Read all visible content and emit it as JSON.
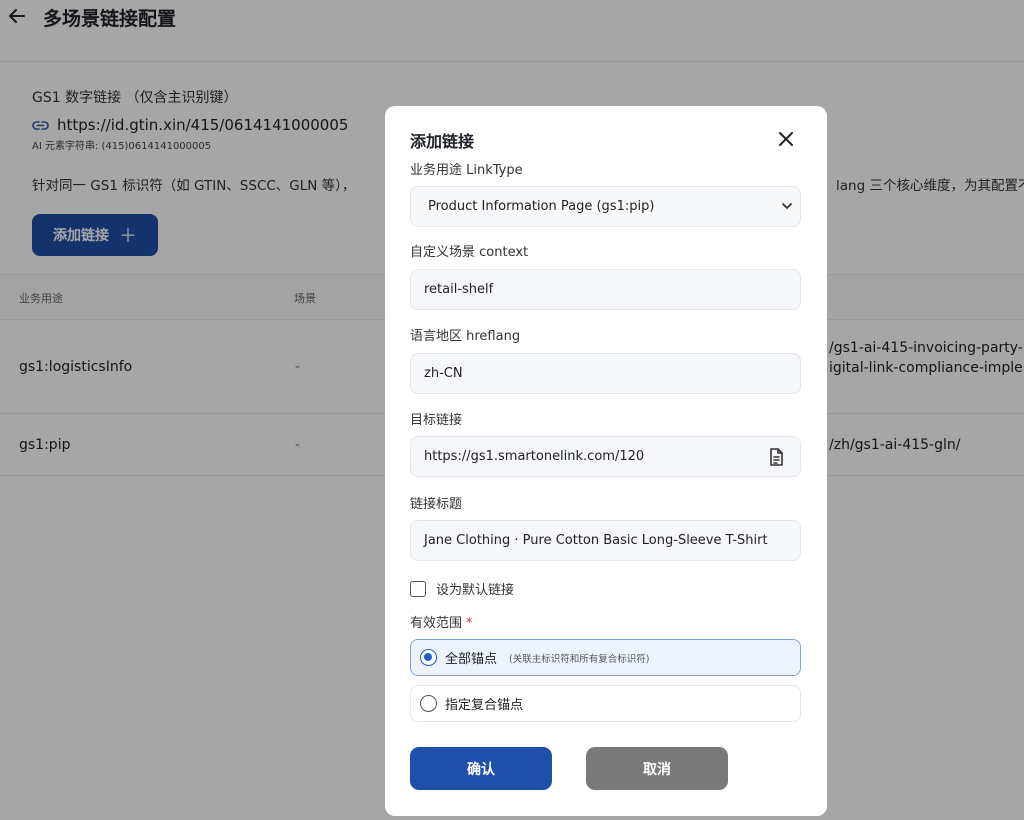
{
  "header": {
    "back_icon": "arrow-left-icon",
    "title": "多场景链接配置"
  },
  "gs1": {
    "title": "GS1 数字链接 （仅含主识别键）",
    "link_icon": "link-icon",
    "url": "https://id.gtin.xin/415/0614141000005",
    "ai_caption": "AI 元素字符串: (415)0614141000005",
    "description_left": "针对同一 GS1 标识符（如 GTIN、SSCC、GLN 等），",
    "description_right": "lang 三个核心维度，为其配置不"
  },
  "add_button": {
    "label": "添加链接",
    "plus": "＋"
  },
  "table": {
    "headers": [
      "业务用途",
      "场景"
    ],
    "rows": [
      {
        "link_type": "gs1:logisticsInfo",
        "context": "-",
        "url_line1": "/gs1-ai-415-invoicing-party-",
        "url_line2": "igital-link-compliance-imple"
      },
      {
        "link_type": "gs1:pip",
        "context": "-",
        "url_line1": "/zh/gs1-ai-415-gln/",
        "url_line2": ""
      }
    ]
  },
  "modal": {
    "title": "添加链接",
    "close_icon": "close-icon",
    "link_type": {
      "label": "业务用途 LinkType",
      "value": "Product Information Page (gs1:pip)"
    },
    "context": {
      "label": "自定义场景 context",
      "value": "retail-shelf"
    },
    "hreflang": {
      "label": "语言地区 hreflang",
      "value": "zh-CN"
    },
    "target": {
      "label": "目标链接",
      "value": "https://gs1.smartonelink.com/120",
      "icon": "document-icon"
    },
    "link_title": {
      "label": "链接标题",
      "value": "Jane Clothing · Pure Cotton Basic Long-Sleeve T-Shirt"
    },
    "default_checkbox": {
      "label": "设为默认链接",
      "checked": false
    },
    "scope": {
      "label": "有效范围",
      "required_mark": "*",
      "options": [
        {
          "label": "全部锚点",
          "note": "(关联主标识符和所有复合标识符)",
          "selected": true
        },
        {
          "label": "指定复合锚点",
          "note": "",
          "selected": false
        }
      ]
    },
    "confirm_label": "确认",
    "cancel_label": "取消"
  },
  "colors": {
    "primary": "#1f4fa8",
    "cancel": "#7a7a7a",
    "required": "#d9363e",
    "selected_bg": "#edf3fd"
  }
}
